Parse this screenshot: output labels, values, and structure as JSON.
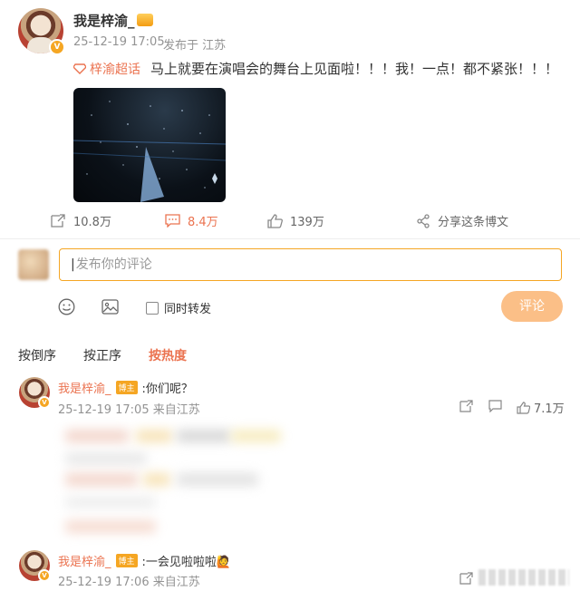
{
  "post": {
    "author": "我是梓渝_",
    "time": "25-12-19 17:05",
    "source": "发布于 江苏",
    "topic": "梓渝超话",
    "text": "马上就要在演唱会的舞台上见面啦！！！我！一点！都不紧张！！！",
    "image_caption": "演唱会舞台灯光图",
    "v_badge": "V"
  },
  "actions": {
    "repost": "10.8万",
    "comment": "8.4万",
    "like": "139万",
    "share": "分享这条博文"
  },
  "composer": {
    "placeholder": "发布你的评论",
    "repost_checkbox_label": "同时转发",
    "submit": "评论"
  },
  "sort": {
    "latest": "按倒序",
    "oldest": "按正序",
    "hot": "按热度"
  },
  "comments": [
    {
      "author": "我是梓渝_",
      "tag": "博主",
      "text": ":你们呢？",
      "time": "25-12-19 17:05 来自江苏",
      "likes": "7.1万"
    },
    {
      "author": "我是梓渝_",
      "tag": "博主",
      "text": ":一会见啦啦啦🙋",
      "time": "25-12-19 17:06 来自江苏"
    }
  ],
  "colors": {
    "accent": "#eb7350",
    "gold": "#f5a623",
    "submit_bg": "#fbbf87"
  }
}
